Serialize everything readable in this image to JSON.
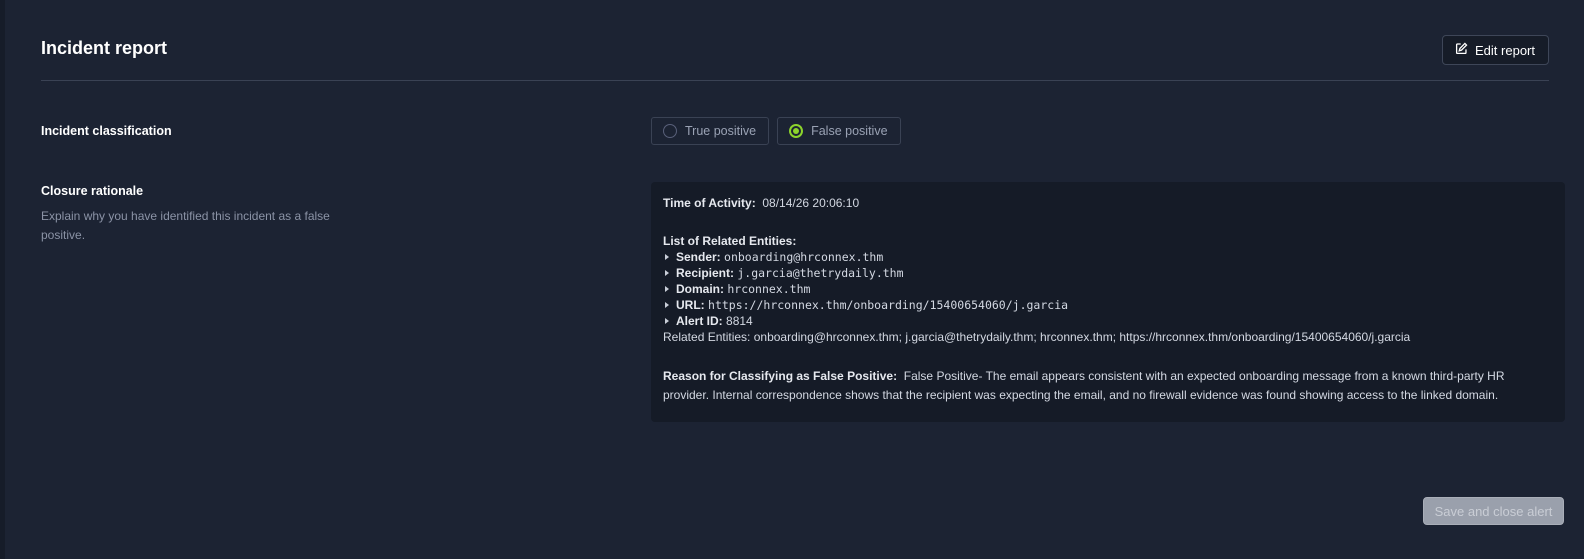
{
  "header": {
    "title": "Incident report",
    "edit_label": "Edit report"
  },
  "classification": {
    "label": "Incident classification",
    "options": [
      {
        "label": "True positive",
        "selected": false
      },
      {
        "label": "False positive",
        "selected": true
      }
    ]
  },
  "rationale": {
    "label": "Closure rationale",
    "helper": "Explain why you have identified this incident as a false positive.",
    "time_label": "Time of Activity:",
    "time_value": "08/14/26 20:06:10",
    "entities_heading": "List of Related Entities:",
    "entities": [
      {
        "key": "Sender:",
        "value": "onboarding@hrconnex.thm",
        "mono": true
      },
      {
        "key": "Recipient:",
        "value": "j.garcia@thetrydaily.thm",
        "mono": true
      },
      {
        "key": "Domain:",
        "value": "hrconnex.thm",
        "mono": true
      },
      {
        "key": "URL:",
        "value": "https://hrconnex.thm/onboarding/15400654060/j.garcia",
        "mono": true
      },
      {
        "key": "Alert ID:",
        "value": "8814",
        "mono": false
      }
    ],
    "related_summary": "Related Entities: onboarding@hrconnex.thm; j.garcia@thetrydaily.thm; hrconnex.thm; https://hrconnex.thm/onboarding/15400654060/j.garcia",
    "reason_label": "Reason for Classifying as False Positive:",
    "reason_text": "False Positive- The email appears consistent with an expected onboarding message from a known third-party HR provider. Internal correspondence shows that the recipient was expecting the email, and no firewall evidence was found showing access to the linked domain."
  },
  "footer": {
    "save_label": "Save and close alert"
  },
  "colors": {
    "background": "#1c2333",
    "accent": "#8cd42c",
    "panel": "#151b27"
  }
}
